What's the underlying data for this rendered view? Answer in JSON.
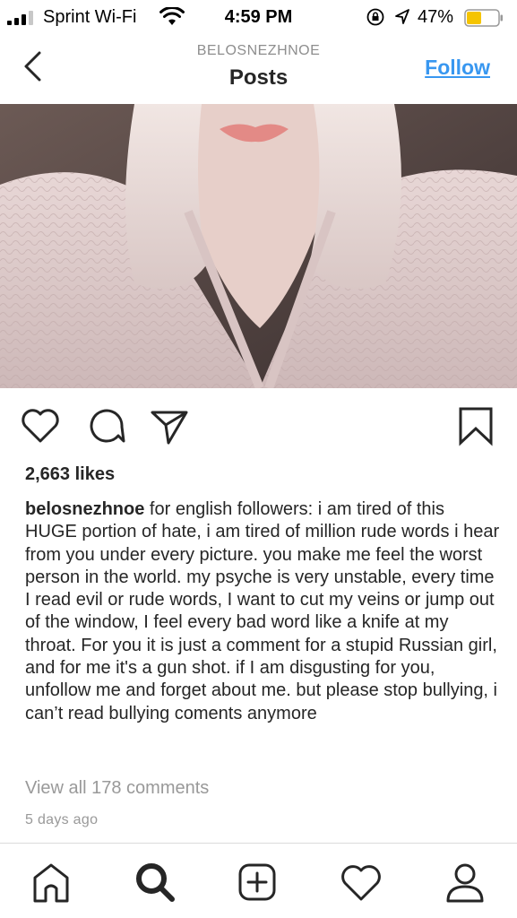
{
  "status_bar": {
    "carrier": "Sprint Wi-Fi",
    "time": "4:59 PM",
    "battery_percent": "47%",
    "battery_level": 0.47,
    "battery_color": "#f5c400"
  },
  "header": {
    "username": "BELOSNEZHNOE",
    "title": "Posts",
    "follow_label": "Follow",
    "accent_color": "#3897f0"
  },
  "post": {
    "likes": "2,663 likes",
    "caption_user": "belosnezhnoe",
    "caption_text": "for english followers: i am tired of this HUGE portion of hate, i am tired of million rude words i hear from you under every picture. you make me feel the worst person in the world. my psyche is very unstable, every time I read evil or rude words, I want to cut my veins or jump out of the window, I feel every bad word like a knife at my throat.  For you it is just a comment for a stupid Russian girl, and for me it's a gun shot. if I am disgusting for you, unfollow me and forget about me. but please stop bullying, i can’t read bullying coments anymore",
    "view_comments": "View all 178 comments",
    "time_ago": "5 days ago"
  },
  "icons": {
    "actions": [
      "heart-icon",
      "comment-icon",
      "share-icon",
      "bookmark-icon"
    ],
    "tabs": [
      "home-icon",
      "search-icon",
      "add-post-icon",
      "activity-heart-icon",
      "profile-icon"
    ]
  }
}
